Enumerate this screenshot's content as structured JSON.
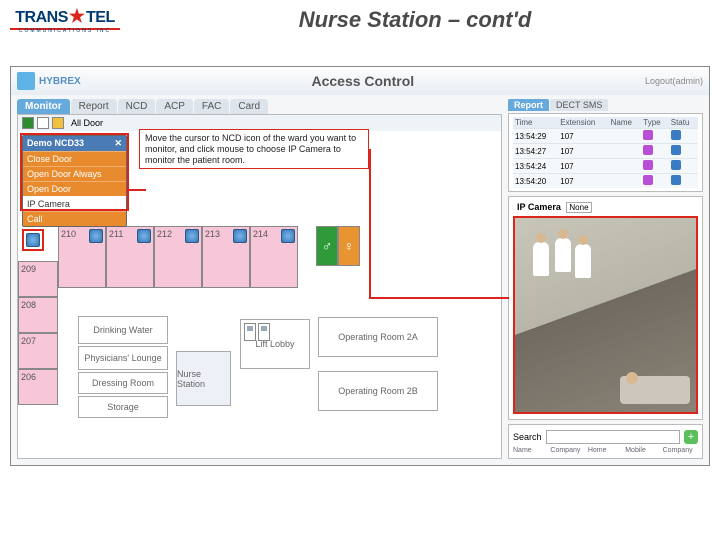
{
  "slide": {
    "title": "Nurse Station – cont'd"
  },
  "logo": {
    "trans": "TRANS",
    "tel": "TEL",
    "sub": "COMMUNICATIONS  INC"
  },
  "app": {
    "brand": "HYBREX",
    "title": "Access Control",
    "logout": "Logout(admin)"
  },
  "left_tabs": [
    "Monitor",
    "Report",
    "NCD",
    "ACP",
    "FAC",
    "Card"
  ],
  "right_tabs": [
    "Report",
    "DECT SMS"
  ],
  "toolbar": {
    "alldoor": "All Door"
  },
  "popup": {
    "title": "Demo NCD33",
    "close": "✕",
    "items": [
      "Close Door",
      "Open Door Always",
      "Open Door",
      "IP Camera",
      "Call"
    ]
  },
  "callout": "Move the cursor to NCD icon of the ward you want to monitor, and click mouse to choose IP Camera to monitor the patient room.",
  "rooms": [
    "209",
    "210",
    "211",
    "212",
    "213",
    "214",
    "208",
    "207",
    "206"
  ],
  "areas": {
    "drinking": "Drinking Water",
    "phys": "Physicians' Lounge",
    "dressing": "Dressing Room",
    "storage": "Storage",
    "nurse": "Nurse Station",
    "lift": "Lift Lobby",
    "op2a": "Operating Room 2A",
    "op2b": "Operating Room 2B"
  },
  "log": {
    "columns": [
      "Time",
      "Extension",
      "Name",
      "Type",
      "Statu"
    ],
    "rows": [
      {
        "time": "13:54:29",
        "ext": "107",
        "name": ""
      },
      {
        "time": "13:54:27",
        "ext": "107",
        "name": ""
      },
      {
        "time": "13:54:24",
        "ext": "107",
        "name": ""
      },
      {
        "time": "13:54:20",
        "ext": "107",
        "name": ""
      }
    ]
  },
  "ipcamera": {
    "label": "IP Camera",
    "selected": "None"
  },
  "search": {
    "label": "Search",
    "placeholder": ""
  },
  "contact_cols": [
    "Name",
    "Company",
    "Home",
    "Mobile",
    "Company"
  ]
}
